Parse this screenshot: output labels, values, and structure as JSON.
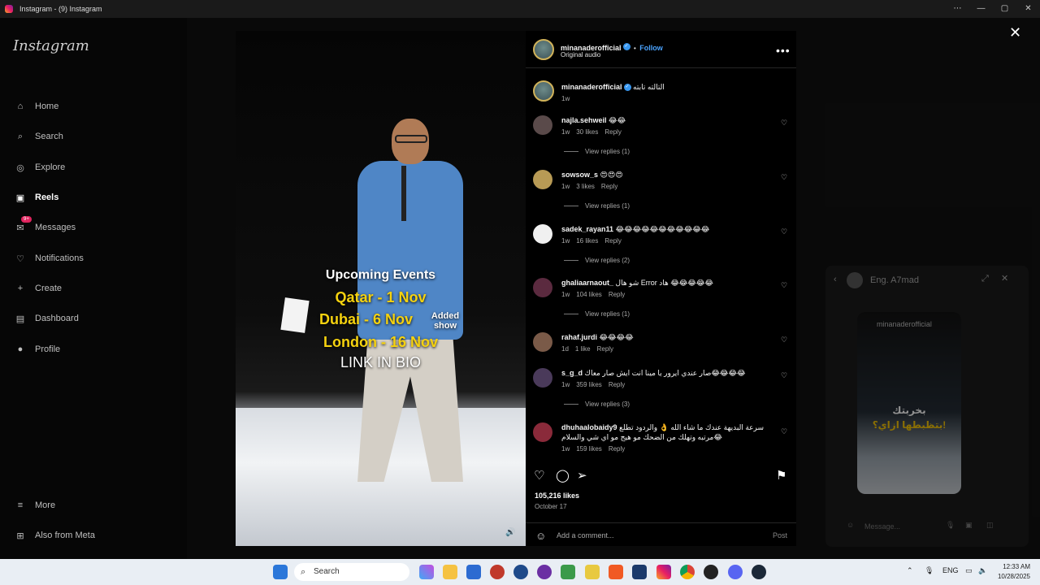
{
  "window": {
    "title": "Instagram - (9) Instagram",
    "controls": [
      "⋯",
      "—",
      "▢",
      "✕"
    ]
  },
  "sidebar": {
    "logo": "Instagram",
    "items": [
      {
        "label": "Home",
        "icon": "home-icon",
        "glyph": "⌂"
      },
      {
        "label": "Search",
        "icon": "search-icon",
        "glyph": "⌕"
      },
      {
        "label": "Explore",
        "icon": "compass-icon",
        "glyph": "◎"
      },
      {
        "label": "Reels",
        "icon": "reels-icon",
        "glyph": "▣"
      },
      {
        "label": "Messages",
        "icon": "messenger-icon",
        "glyph": "✉",
        "badge": "9+"
      },
      {
        "label": "Notifications",
        "icon": "heart-icon",
        "glyph": "♡"
      },
      {
        "label": "Create",
        "icon": "plus-icon",
        "glyph": "+"
      },
      {
        "label": "Dashboard",
        "icon": "dashboard-icon",
        "glyph": "▤"
      },
      {
        "label": "Profile",
        "icon": "avatar-icon",
        "glyph": "●"
      }
    ],
    "more": {
      "label": "More",
      "glyph": "≡"
    },
    "meta": {
      "label": "Also from Meta",
      "glyph": "⊞"
    }
  },
  "video": {
    "lines": [
      "Upcoming Events",
      "Qatar - 1 Nov",
      "Dubai - 6 Nov",
      "Added show",
      "London - 16 Nov",
      "LINK IN BIO"
    ],
    "mute_icon": "🔊"
  },
  "post": {
    "username": "minanaderofficial",
    "follow": "Follow",
    "separator": "•",
    "audio": "Original audio",
    "caption": "التالته تابته",
    "caption_time": "1w",
    "likes": "105,216 likes",
    "date": "October 17",
    "add_comment_placeholder": "Add a comment...",
    "post_label": "Post"
  },
  "comments": [
    {
      "user": "najla.sehweil",
      "text": "😂😂",
      "time": "1w",
      "likes": "30 likes",
      "reply": "Reply",
      "view_replies": "View replies (1)",
      "avatar_color": "#5a4a4a"
    },
    {
      "user": "sowsow_s",
      "text": "😍😍😍",
      "time": "1w",
      "likes": "3 likes",
      "reply": "Reply",
      "view_replies": "View replies (1)",
      "avatar_color": "#b89a55"
    },
    {
      "user": "sadek_rayan11",
      "text": "😂😂😂😂😂😂😂😂😂😂😂",
      "time": "1w",
      "likes": "16 likes",
      "reply": "Reply",
      "view_replies": "View replies (2)",
      "avatar_color": "#f0f0f0"
    },
    {
      "user": "ghaliaarnaout_",
      "text": "شو هال Error هاد 😂😂😂😂😂",
      "time": "1w",
      "likes": "104 likes",
      "reply": "Reply",
      "view_replies": "View replies (1)",
      "avatar_color": "#5b2a3f"
    },
    {
      "user": "rahaf.jurdi",
      "text": "😂😂😂😂",
      "time": "1d",
      "likes": "1 like",
      "reply": "Reply",
      "view_replies": "",
      "avatar_color": "#7a5a48"
    },
    {
      "user": "s_g_d",
      "text": "صار عندي ايرور يا مينا انت ايش صار معاك😂😂😂😂",
      "time": "1w",
      "likes": "359 likes",
      "reply": "Reply",
      "view_replies": "View replies (3)",
      "avatar_color": "#4a3a5a"
    },
    {
      "user": "dhuhaalobaidy9",
      "text": "سرعة البديهة عندك ما شاء الله 👌 والردود تطلع مرتبه وتهلك من الضحك مو هيج مو اي شي والسلام😂",
      "time": "1w",
      "likes": "159 likes",
      "reply": "Reply",
      "view_replies": "",
      "avatar_color": "#8a2a3a"
    }
  ],
  "chat": {
    "name": "Eng. A7mad",
    "shared_user": "minanaderofficial",
    "overlay_line1": "بخربتك",
    "overlay_line2": "بتظبطها ازاي؟!",
    "message_placeholder": "Message..."
  },
  "taskbar": {
    "search": "Search",
    "lang": "ENG",
    "time": "12:33 AM",
    "date": "10/28/2025"
  }
}
